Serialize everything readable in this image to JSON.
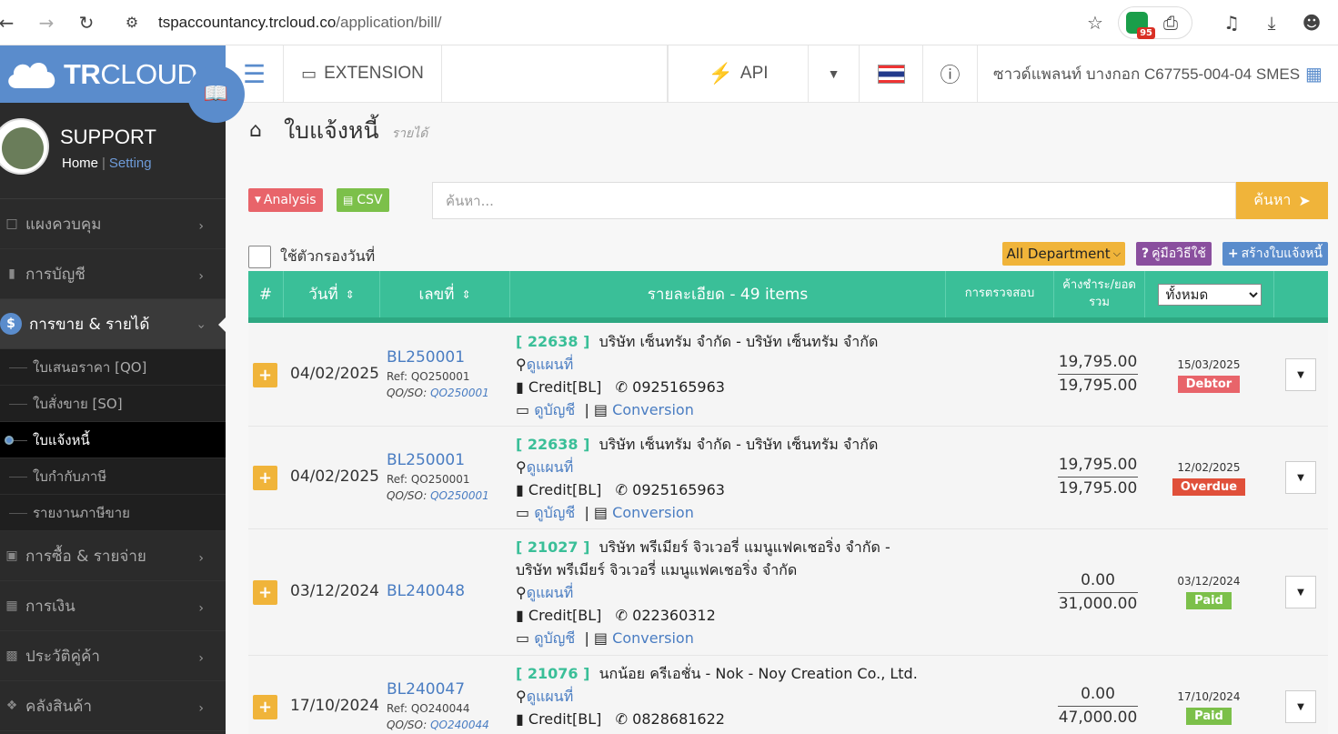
{
  "browser": {
    "url_host": "tspaccountancy.trcloud.co",
    "url_path": "/application/bill/",
    "ext_badge": "95"
  },
  "sidebar": {
    "logo_bold": "TR",
    "logo_light": "CLOUD",
    "user": "SUPPORT",
    "home": "Home",
    "sep": "|",
    "setting": "Setting",
    "menu": [
      {
        "label": "แผงควบคุม",
        "icon": "monitor-icon"
      },
      {
        "label": "การบัญชี",
        "icon": "book-icon"
      },
      {
        "label": "การขาย & รายได้",
        "icon": "dollar-icon"
      },
      {
        "label": "การซื้อ & รายจ่าย",
        "icon": "cart-icon"
      },
      {
        "label": "การเงิน",
        "icon": "calendar-icon"
      },
      {
        "label": "ประวัติคู่ค้า",
        "icon": "contact-icon"
      },
      {
        "label": "คลังสินค้า",
        "icon": "cubes-icon"
      }
    ],
    "submenu": [
      "ใบเสนอราคา [QO]",
      "ใบสั่งขาย [SO]",
      "ใบแจ้งหนี้",
      "ใบกำกับภาษี",
      "รายงานภาษีขาย"
    ]
  },
  "topbar": {
    "extension": "EXTENSION",
    "api": "API",
    "company": "ซาวด์แพลนท์ บางกอก C67755-004-04 SMES"
  },
  "page": {
    "title": "ใบแจ้งหนี้",
    "subtitle": "รายได้"
  },
  "toolbar": {
    "analysis": "Analysis",
    "csv": "CSV",
    "search_placeholder": "ค้นหา...",
    "search_button": "ค้นหา",
    "date_filter": "ใช้ตัวกรองวันที่",
    "department": "All Department",
    "manual": "คู่มือวิธีใช้",
    "create": "สร้างใบแจ้งหนี้"
  },
  "table": {
    "headers": {
      "num": "#",
      "date": "วันที่",
      "docno": "เลขที่",
      "detail": "รายละเอียด - 49 items",
      "check": "การตรวจสอบ",
      "balance": "ค้างชำระ/ยอด รวม",
      "status_filter": "ทั้งหมด"
    },
    "rows": [
      {
        "date": "04/02/2025",
        "docno": "BL250001",
        "ref": "Ref: QO250001",
        "qoso_label": "QO/SO:",
        "qoso": "QO250001",
        "code": "[ 22638 ]",
        "customer": "บริษัท เซ็นทรัม จำกัด - บริษัท เซ็นทรัม จำกัด",
        "customer2": "",
        "map": "ดูแผนที่",
        "credit": "Credit[BL]",
        "phone": "0925165963",
        "account": "ดูบัญชี",
        "conversion": "Conversion",
        "outstanding": "19,795.00",
        "total": "19,795.00",
        "due": "15/03/2025",
        "status": "Debtor"
      },
      {
        "date": "04/02/2025",
        "docno": "BL250001",
        "ref": "Ref: QO250001",
        "qoso_label": "QO/SO:",
        "qoso": "QO250001",
        "code": "[ 22638 ]",
        "customer": "บริษัท เซ็นทรัม จำกัด - บริษัท เซ็นทรัม จำกัด",
        "customer2": "",
        "map": "ดูแผนที่",
        "credit": "Credit[BL]",
        "phone": "0925165963",
        "account": "ดูบัญชี",
        "conversion": "Conversion",
        "outstanding": "19,795.00",
        "total": "19,795.00",
        "due": "12/02/2025",
        "status": "Overdue"
      },
      {
        "date": "03/12/2024",
        "docno": "BL240048",
        "ref": "",
        "qoso_label": "",
        "qoso": "",
        "code": "[ 21027 ]",
        "customer": "บริษัท พรีเมียร์ จิวเวอรี่ แมนูแฟคเชอริ่ง จำกัด -",
        "customer2": "บริษัท พรีเมียร์ จิวเวอรี่ แมนูแฟคเชอริ่ง จำกัด",
        "map": "ดูแผนที่",
        "credit": "Credit[BL]",
        "phone": "022360312",
        "account": "ดูบัญชี",
        "conversion": "Conversion",
        "outstanding": "0.00",
        "total": "31,000.00",
        "due": "03/12/2024",
        "status": "Paid"
      },
      {
        "date": "17/10/2024",
        "docno": "BL240047",
        "ref": "Ref: QO240044",
        "qoso_label": "QO/SO:",
        "qoso": "QO240044",
        "code": "[ 21076 ]",
        "customer": "นกน้อย ครีเอชั่น - Nok - Noy Creation Co., Ltd.",
        "customer2": "",
        "map": "ดูแผนที่",
        "credit": "Credit[BL]",
        "phone": "0828681622",
        "account": "",
        "conversion": "",
        "outstanding": "0.00",
        "total": "47,000.00",
        "due": "17/10/2024",
        "status": "Paid"
      }
    ]
  },
  "colors": {
    "accent": "#5a8ccc",
    "table_header": "#3abf98",
    "warning": "#f0b43a"
  }
}
